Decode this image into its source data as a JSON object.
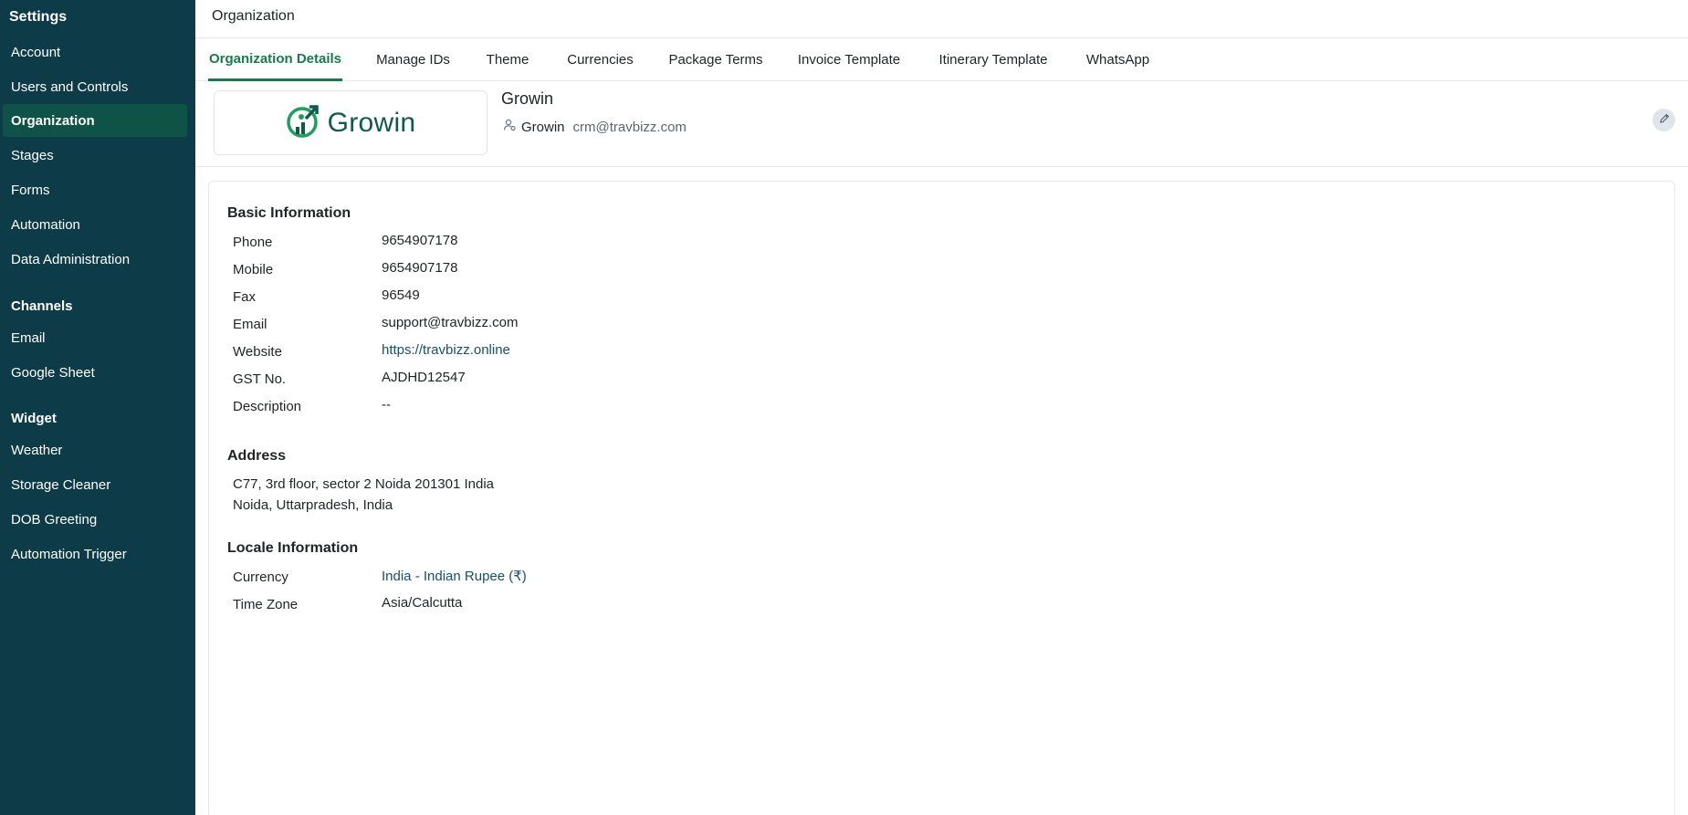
{
  "sidebar": {
    "title": "Settings",
    "items": [
      {
        "label": "Account"
      },
      {
        "label": "Users and Controls"
      },
      {
        "label": "Organization"
      },
      {
        "label": "Stages"
      },
      {
        "label": "Forms"
      },
      {
        "label": "Automation"
      },
      {
        "label": "Data Administration"
      }
    ],
    "channels_heading": "Channels",
    "channels": [
      {
        "label": "Email"
      },
      {
        "label": "Google Sheet"
      }
    ],
    "widget_heading": "Widget",
    "widgets": [
      {
        "label": "Weather"
      },
      {
        "label": "Storage Cleaner"
      },
      {
        "label": "DOB Greeting"
      },
      {
        "label": "Automation Trigger"
      }
    ],
    "active_item": "Organization"
  },
  "header": {
    "title": "Organization"
  },
  "tabs": [
    {
      "label": "Organization Details"
    },
    {
      "label": "Manage IDs"
    },
    {
      "label": "Theme"
    },
    {
      "label": "Currencies"
    },
    {
      "label": "Package Terms"
    },
    {
      "label": "Invoice Template"
    },
    {
      "label": "Itinerary Template"
    },
    {
      "label": "WhatsApp"
    }
  ],
  "active_tab": "Organization Details",
  "org": {
    "logo_text": "Growin",
    "name": "Growin",
    "owner": "Growin",
    "email": "crm@travbizz.com"
  },
  "basic": {
    "title": "Basic Information",
    "rows": [
      {
        "label": "Phone",
        "value": "9654907178"
      },
      {
        "label": "Mobile",
        "value": "9654907178"
      },
      {
        "label": "Fax",
        "value": "96549"
      },
      {
        "label": "Email",
        "value": "support@travbizz.com"
      },
      {
        "label": "Website",
        "value": "https://travbizz.online"
      },
      {
        "label": "GST No.",
        "value": "AJDHD12547"
      },
      {
        "label": "Description",
        "value": "--"
      }
    ]
  },
  "address": {
    "title": "Address",
    "line1": "C77, 3rd floor, sector 2 Noida 201301 India",
    "line2": "Noida, Uttarpradesh, India"
  },
  "locale": {
    "title": "Locale Information",
    "rows": [
      {
        "label": "Currency",
        "value": "India - Indian Rupee (₹)"
      },
      {
        "label": "Time Zone",
        "value": "Asia/Calcutta"
      }
    ]
  },
  "colors": {
    "sidebar_bg": "#0d3b47",
    "sidebar_active": "#0f5346",
    "accent": "#1b7a4d",
    "link": "#17506b"
  }
}
